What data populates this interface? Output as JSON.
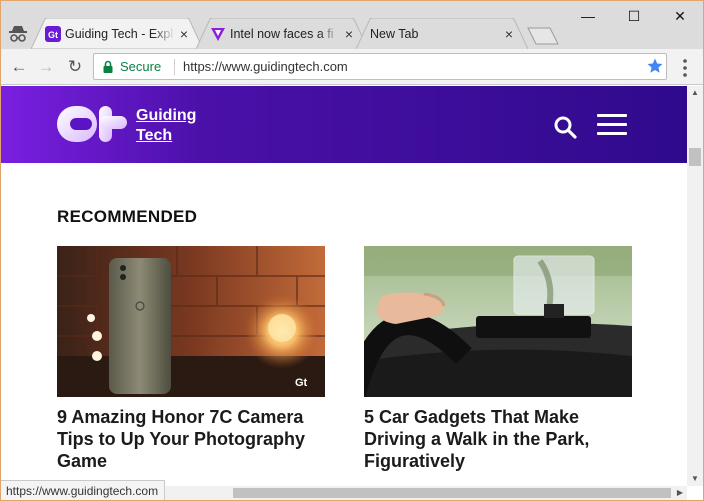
{
  "browser": {
    "tabs": [
      {
        "title": "Guiding Tech - Expl",
        "active": true
      },
      {
        "title": "Intel now faces a fi",
        "active": false
      },
      {
        "title": "New Tab",
        "active": false
      }
    ],
    "close_glyph": "×",
    "window_controls": {
      "minimize": "—",
      "maximize": "☐",
      "close": "✕"
    },
    "nav": {
      "back": "←",
      "forward": "→",
      "reload": "↻"
    },
    "security_label": "Secure",
    "url": "https://www.guidingtech.com",
    "status_url": "https://www.guidingtech.com",
    "colors": {
      "secure": "#0b8043",
      "star": "#4285f4"
    }
  },
  "site": {
    "brand_line1": "Guiding",
    "brand_line2": "Tech",
    "header_colors": [
      "#7a1fe0",
      "#2f0a8c"
    ],
    "section_title": "RECOMMENDED",
    "articles": [
      {
        "title": "9 Amazing Honor 7C Camera Tips to Up Your Photography Game"
      },
      {
        "title": "5 Car Gadgets That Make Driving a Walk in the Park, Figuratively"
      }
    ],
    "watermark": "Gt"
  },
  "scroll": {
    "up": "▲",
    "down": "▼",
    "left": "◀",
    "right": "▶"
  }
}
